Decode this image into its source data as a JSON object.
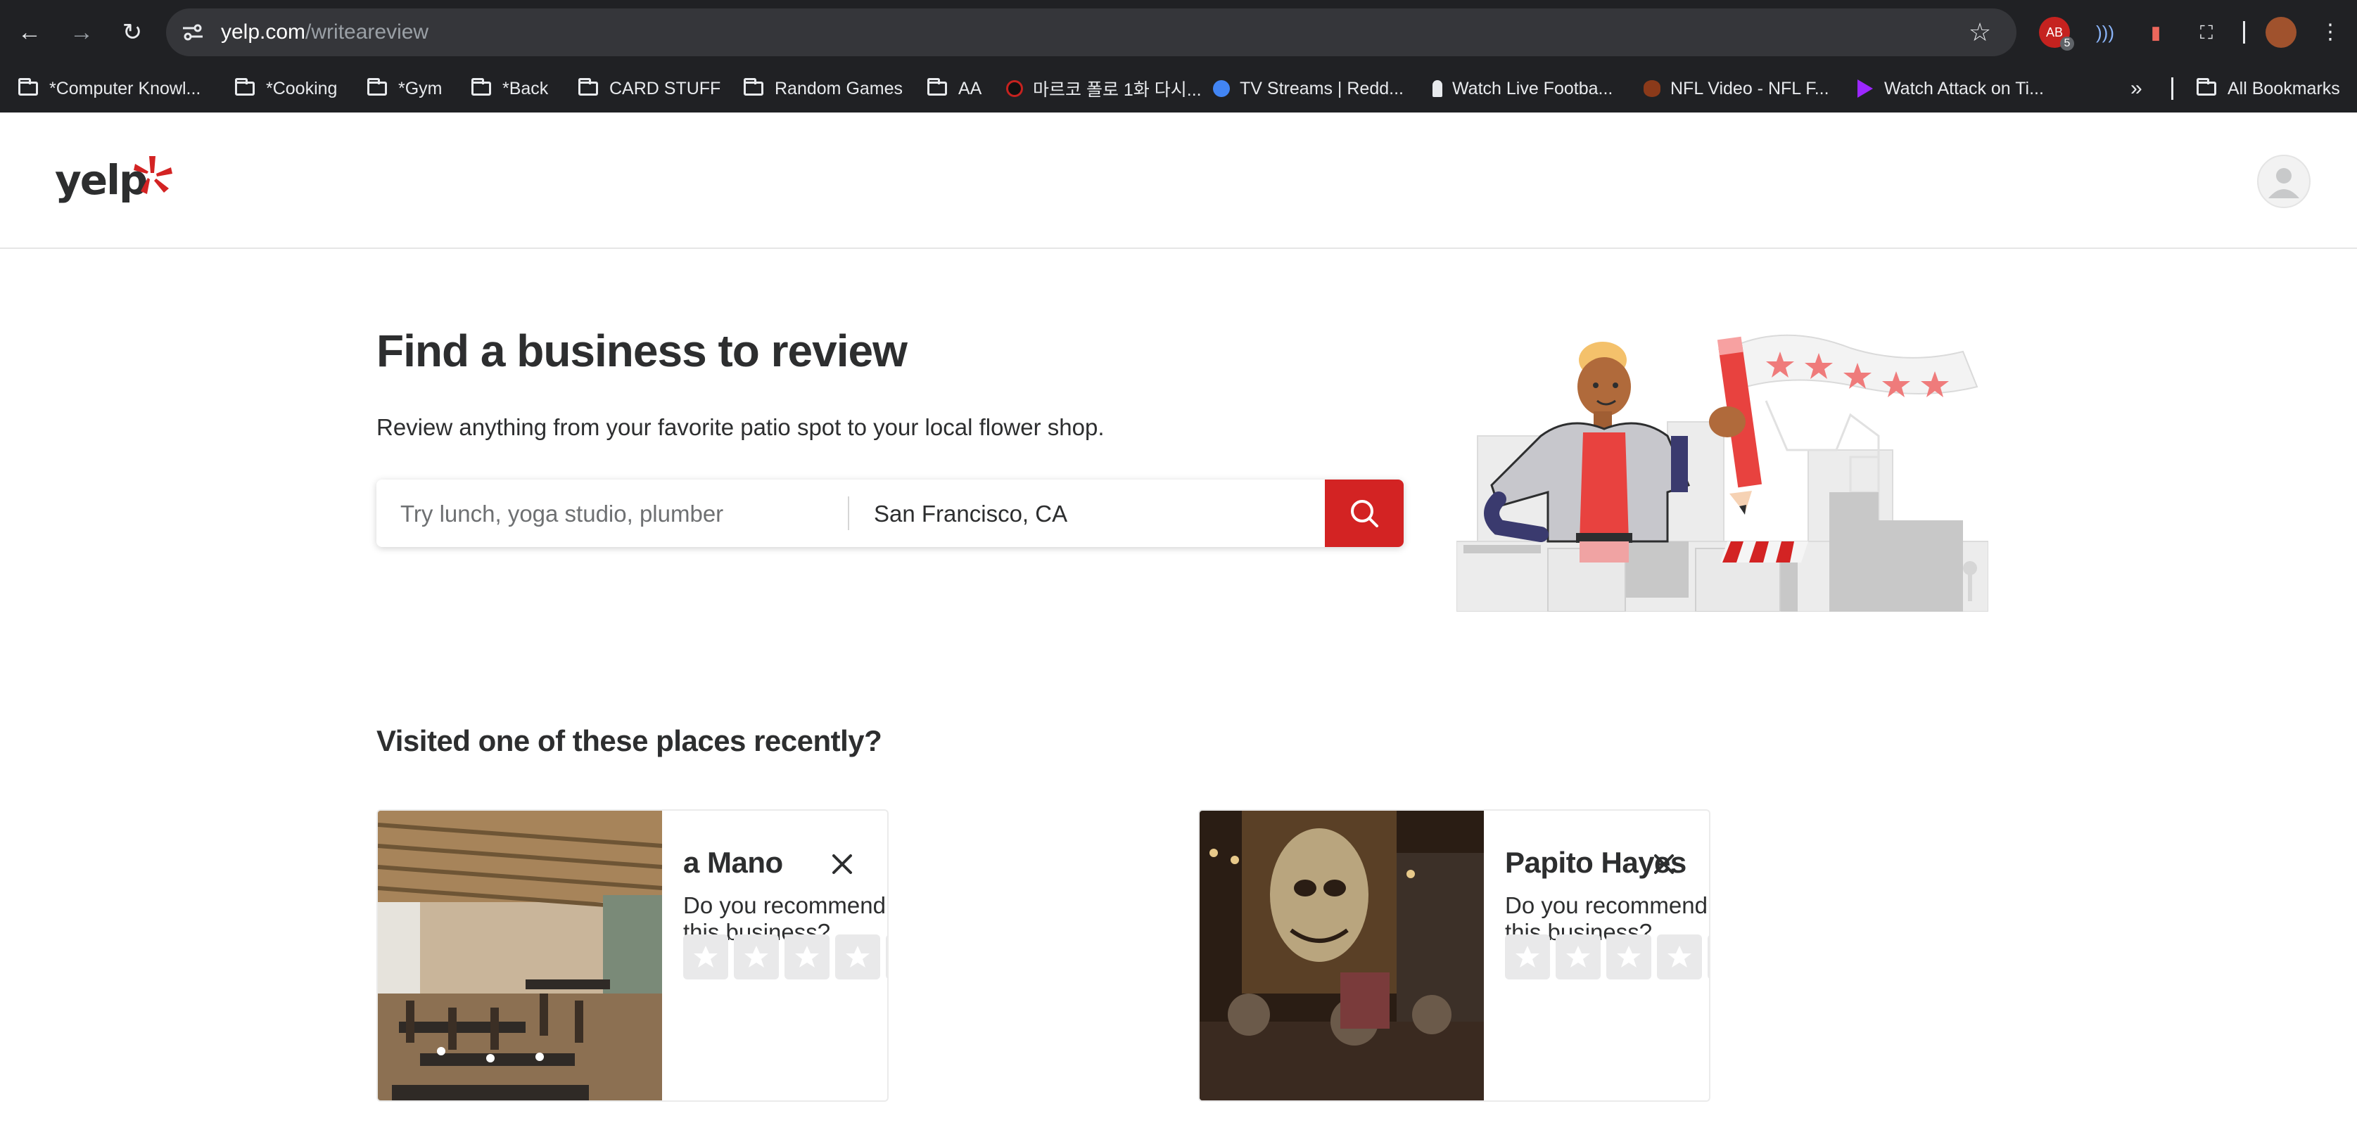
{
  "browser": {
    "url_domain": "yelp.com",
    "url_path": "/writeareview",
    "extension_badge": "5",
    "bookmarks": [
      {
        "label": "*Computer Knowl...",
        "icon": "folder-icon"
      },
      {
        "label": "*Cooking",
        "icon": "folder-icon"
      },
      {
        "label": "*Gym",
        "icon": "folder-icon"
      },
      {
        "label": "*Back",
        "icon": "folder-icon"
      },
      {
        "label": "CARD STUFF",
        "icon": "folder-icon"
      },
      {
        "label": "Random Games",
        "icon": "folder-icon"
      },
      {
        "label": "AA",
        "icon": "folder-icon"
      },
      {
        "label": "마르코 폴로 1화 다시...",
        "icon": "site-icon"
      },
      {
        "label": "TV Streams | Redd...",
        "icon": "site-icon"
      },
      {
        "label": "Watch Live Footba...",
        "icon": "site-icon"
      },
      {
        "label": "NFL Video - NFL F...",
        "icon": "site-icon"
      },
      {
        "label": "Watch Attack on Ti...",
        "icon": "play-icon"
      }
    ],
    "all_bookmarks": "All Bookmarks"
  },
  "site": {
    "logo_text": "yelp",
    "brand_color": "#d32323"
  },
  "hero": {
    "title": "Find a business to review",
    "subtitle": "Review anything from your favorite patio spot to your local flower shop.",
    "find_placeholder": "Try lunch, yoga studio, plumber",
    "near_value": "San Francisco, CA"
  },
  "visited": {
    "heading": "Visited one of these places recently?",
    "cards": [
      {
        "name": "a Mano",
        "question": "Do you recommend this business?",
        "rating": 0,
        "max_rating": 5
      },
      {
        "name": "Papito Hayes",
        "question": "Do you recommend this business?",
        "rating": 0,
        "max_rating": 5
      }
    ]
  }
}
